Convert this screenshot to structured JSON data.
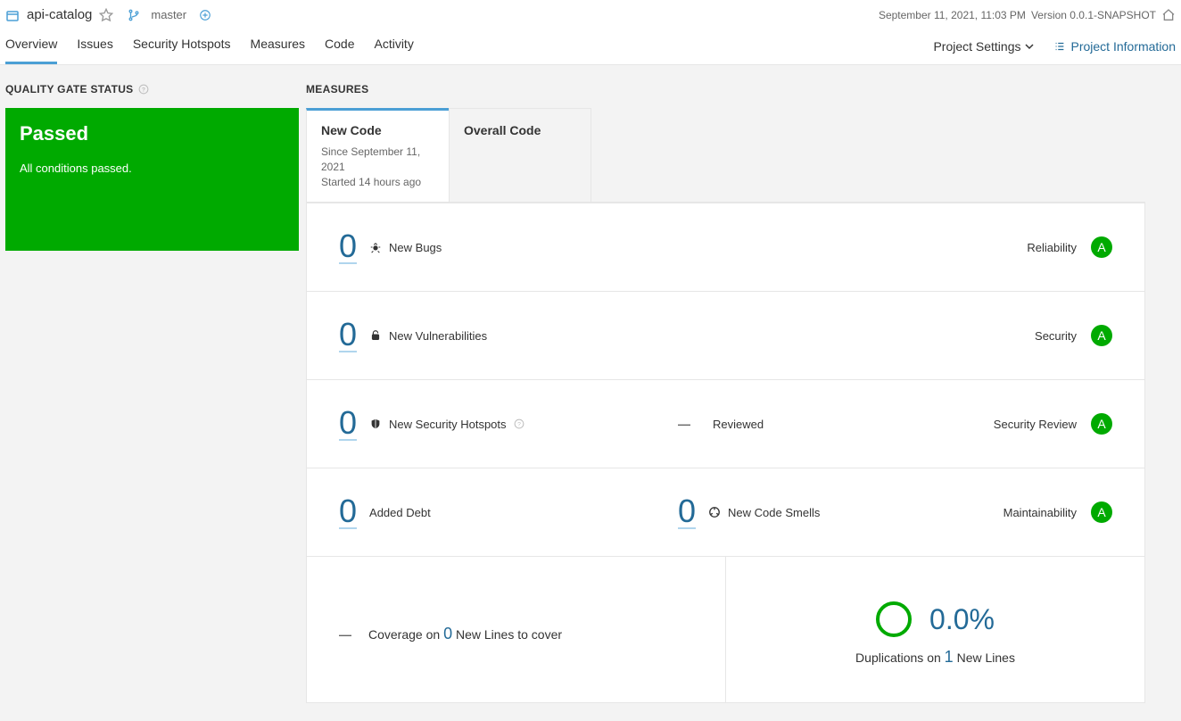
{
  "header": {
    "project_name": "api-catalog",
    "branch_name": "master",
    "date_text": "September 11, 2021, 11:03 PM",
    "version_text": "Version 0.0.1-SNAPSHOT"
  },
  "nav": {
    "tabs": [
      "Overview",
      "Issues",
      "Security Hotspots",
      "Measures",
      "Code",
      "Activity"
    ],
    "active_index": 0,
    "project_settings": "Project Settings",
    "project_info": "Project Information"
  },
  "quality_gate": {
    "section_title": "QUALITY GATE STATUS",
    "status": "Passed",
    "subtext": "All conditions passed."
  },
  "measures": {
    "section_title": "MEASURES",
    "tabs": [
      {
        "label": "New Code",
        "sub1": "Since September 11, 2021",
        "sub2": "Started 14 hours ago"
      },
      {
        "label": "Overall Code",
        "sub1": "",
        "sub2": ""
      }
    ],
    "active_tab": 0,
    "rows": [
      {
        "value": "0",
        "label": "New Bugs",
        "category": "Reliability",
        "rating": "A"
      },
      {
        "value": "0",
        "label": "New Vulnerabilities",
        "category": "Security",
        "rating": "A"
      },
      {
        "value": "0",
        "label": "New Security Hotspots",
        "mid_value": "—",
        "mid_label": "Reviewed",
        "category": "Security Review",
        "rating": "A"
      },
      {
        "value": "0",
        "label": "Added Debt",
        "mid_big": "0",
        "mid_label2": "New Code Smells",
        "category": "Maintainability",
        "rating": "A"
      }
    ],
    "coverage": {
      "dash": "—",
      "prefix": "Coverage on ",
      "lines": "0",
      "suffix": " New Lines to cover"
    },
    "duplications": {
      "percent": "0.0%",
      "prefix": "Duplications on ",
      "lines": "1",
      "suffix": " New Lines"
    }
  }
}
